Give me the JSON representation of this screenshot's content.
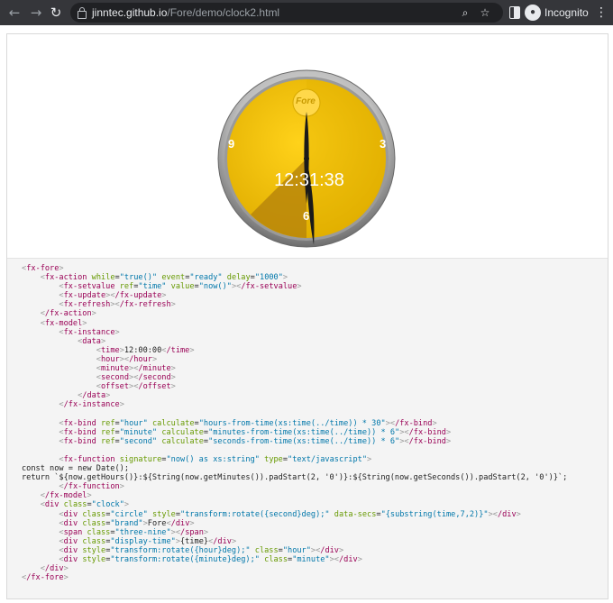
{
  "browser": {
    "url_host": "jinntec.github.io",
    "url_path": "/Fore/demo/clock2.html",
    "incognito_label": "Incognito",
    "icons": [
      "back-arrow-icon",
      "forward-arrow-icon",
      "reload-icon",
      "lock-icon",
      "zoom-icon",
      "star-icon",
      "side-panel-icon",
      "incognito-icon",
      "kebab-menu-icon"
    ]
  },
  "clock": {
    "display_time": "12:31:38",
    "brand": "Fore",
    "numerals": {
      "nine": "9",
      "three": "3",
      "six": "6"
    },
    "hour_value": "12",
    "minute_value": "31",
    "second_value": "38",
    "colors": {
      "face": "#f5c400",
      "bezel": "#8a8a8a",
      "sweep": "#b8860b",
      "hands": "#1a1a1a"
    }
  },
  "code": {
    "lines": [
      "<fx-fore>",
      "    <fx-action while=\"true()\" event=\"ready\" delay=\"1000\">",
      "        <fx-setvalue ref=\"time\" value=\"now()\"></fx-setvalue>",
      "        <fx-update></fx-update>",
      "        <fx-refresh></fx-refresh>",
      "    </fx-action>",
      "    <fx-model>",
      "        <fx-instance>",
      "            <data>",
      "                <time>12:00:00</time>",
      "                <hour></hour>",
      "                <minute></minute>",
      "                <second></second>",
      "                <offset></offset>",
      "            </data>",
      "        </fx-instance>",
      "",
      "        <fx-bind ref=\"hour\" calculate=\"hours-from-time(xs:time(../time)) * 30\"></fx-bind>",
      "        <fx-bind ref=\"minute\" calculate=\"minutes-from-time(xs:time(../time)) * 6\"></fx-bind>",
      "        <fx-bind ref=\"second\" calculate=\"seconds-from-time(xs:time(../time)) * 6\"></fx-bind>",
      "",
      "        <fx-function signature=\"now() as xs:string\" type=\"text/javascript\">",
      "const now = new Date();",
      "return `${now.getHours()}:${String(now.getMinutes()).padStart(2, '0')}:${String(now.getSeconds()).padStart(2, '0')}`;",
      "        </fx-function>",
      "    </fx-model>",
      "    <div class=\"clock\">",
      "        <div class=\"circle\" style=\"transform:rotate({second}deg);\" data-secs=\"{substring(time,7,2)}\"></div>",
      "        <div class=\"brand\">Fore</div>",
      "        <span class=\"three-nine\"></span>",
      "        <div class=\"display-time\">{time}</div>",
      "        <div style=\"transform:rotate({hour}deg);\" class=\"hour\"></div>",
      "        <div style=\"transform:rotate({minute}deg);\" class=\"minute\"></div>",
      "    </div>",
      "</fx-fore>"
    ]
  }
}
